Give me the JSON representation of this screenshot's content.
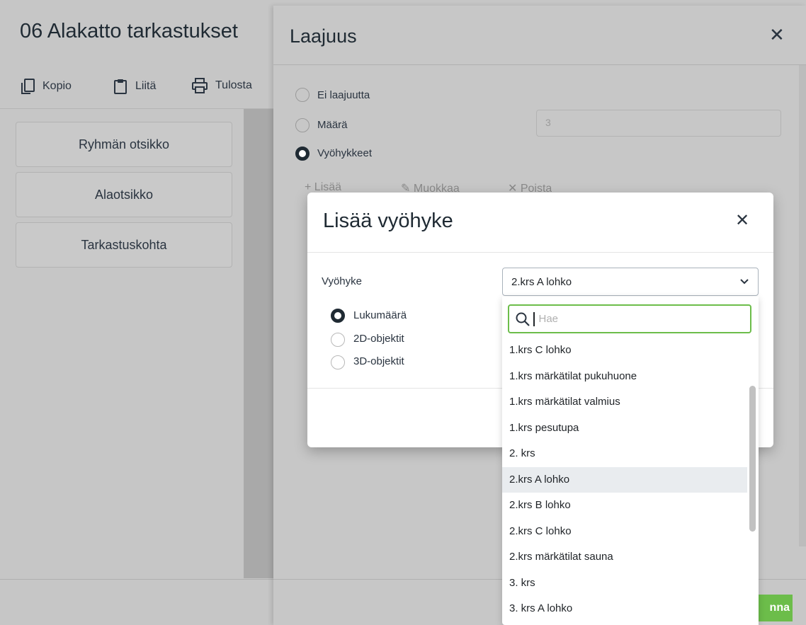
{
  "page": {
    "title": "06 Alakatto tarkastukset",
    "toolbar": {
      "copy_label": "Kopio",
      "paste_label": "Liitä",
      "print_label": "Tulosta"
    },
    "cards": [
      "Ryhmän otsikko",
      "Alaotsikko",
      "Tarkastuskohta"
    ]
  },
  "panel": {
    "title": "Laajuus",
    "options": [
      {
        "label": "Ei laajuutta",
        "selected": false
      },
      {
        "label": "Määrä",
        "selected": false
      },
      {
        "label": "Vyöhykkeet",
        "selected": true
      }
    ],
    "quantity_value": "3",
    "zone_toolbar": {
      "add": "Lisää",
      "edit": "Muokkaa",
      "delete": "Poista"
    },
    "save_label": "nna"
  },
  "modal": {
    "title": "Lisää vyöhyke",
    "zone_label": "Vyöhyke",
    "selected_zone": "2.krs A lohko",
    "count_options": [
      {
        "label": "Lukumäärä",
        "selected": true
      },
      {
        "label": "2D-objektit",
        "selected": false
      },
      {
        "label": "3D-objektit",
        "selected": false
      }
    ],
    "dropdown": {
      "search_placeholder": "Hae",
      "options": [
        "1.krs C lohko",
        "1.krs märkätilat pukuhuone",
        "1.krs märkätilat valmius",
        "1.krs pesutupa",
        "2. krs",
        "2.krs A lohko",
        "2.krs B lohko",
        "2.krs C lohko",
        "2.krs märkätilat sauna",
        "3. krs",
        "3. krs A lohko"
      ],
      "highlighted": "2.krs A lohko"
    }
  },
  "colors": {
    "accent_green": "#6cbd4a",
    "text_dark": "#1f2a33",
    "overlay_gray": "#c7c7c7"
  }
}
